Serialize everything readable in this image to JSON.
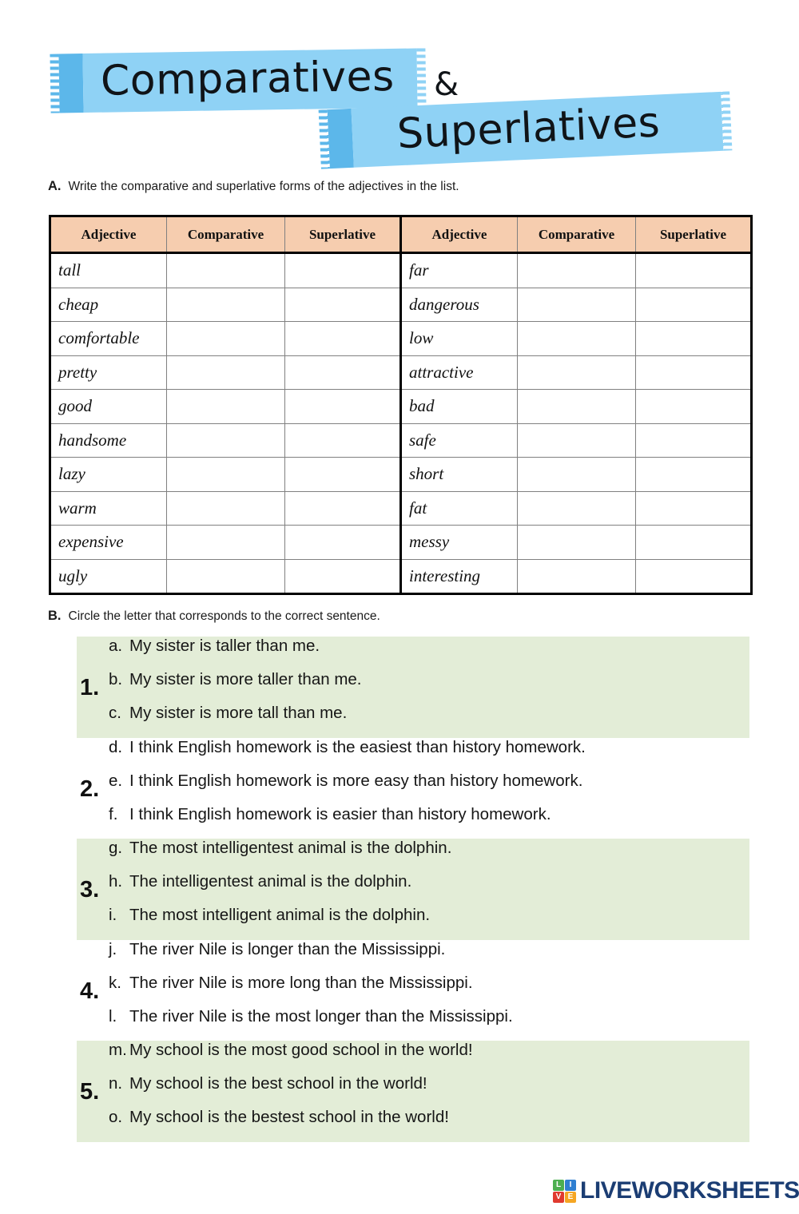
{
  "title": {
    "line1": "Comparatives",
    "ampersand": "&",
    "line2": "Superlatives"
  },
  "colors": {
    "banner_body": "#8fd2f5",
    "banner_tab": "#5cb7ea",
    "table_header_bg": "#f6cdaf",
    "question_band_bg": "#e3edd7",
    "logo_wordmark": "#1b3d73"
  },
  "section_a": {
    "letter": "A.",
    "instruction": "Write the comparative and superlative forms of the adjectives in the list.",
    "table": {
      "headers": [
        "Adjective",
        "Comparative",
        "Superlative",
        "Adjective",
        "Comparative",
        "Superlative"
      ],
      "rows": [
        {
          "left_adjective": "tall",
          "left_comparative": "",
          "left_superlative": "",
          "right_adjective": "far",
          "right_comparative": "",
          "right_superlative": ""
        },
        {
          "left_adjective": "cheap",
          "left_comparative": "",
          "left_superlative": "",
          "right_adjective": "dangerous",
          "right_comparative": "",
          "right_superlative": ""
        },
        {
          "left_adjective": "comfortable",
          "left_comparative": "",
          "left_superlative": "",
          "right_adjective": "low",
          "right_comparative": "",
          "right_superlative": ""
        },
        {
          "left_adjective": "pretty",
          "left_comparative": "",
          "left_superlative": "",
          "right_adjective": "attractive",
          "right_comparative": "",
          "right_superlative": ""
        },
        {
          "left_adjective": "good",
          "left_comparative": "",
          "left_superlative": "",
          "right_adjective": "bad",
          "right_comparative": "",
          "right_superlative": ""
        },
        {
          "left_adjective": "handsome",
          "left_comparative": "",
          "left_superlative": "",
          "right_adjective": "safe",
          "right_comparative": "",
          "right_superlative": ""
        },
        {
          "left_adjective": "lazy",
          "left_comparative": "",
          "left_superlative": "",
          "right_adjective": "short",
          "right_comparative": "",
          "right_superlative": ""
        },
        {
          "left_adjective": "warm",
          "left_comparative": "",
          "left_superlative": "",
          "right_adjective": "fat",
          "right_comparative": "",
          "right_superlative": ""
        },
        {
          "left_adjective": "expensive",
          "left_comparative": "",
          "left_superlative": "",
          "right_adjective": "messy",
          "right_comparative": "",
          "right_superlative": ""
        },
        {
          "left_adjective": "ugly",
          "left_comparative": "",
          "left_superlative": "",
          "right_adjective": "interesting",
          "right_comparative": "",
          "right_superlative": ""
        }
      ]
    }
  },
  "section_b": {
    "letter": "B.",
    "instruction": "Circle the letter that corresponds to the correct sentence.",
    "groups": [
      {
        "number": "1.",
        "shaded": true,
        "options": [
          {
            "letter": "a.",
            "text": "My sister is taller than me."
          },
          {
            "letter": "b.",
            "text": "My sister is more taller than me."
          },
          {
            "letter": "c.",
            "text": "My sister is more tall than me."
          }
        ]
      },
      {
        "number": "2.",
        "shaded": false,
        "options": [
          {
            "letter": "d.",
            "text": "I think English homework is the easiest than history homework."
          },
          {
            "letter": "e.",
            "text": "I think English homework is more easy than history homework."
          },
          {
            "letter": "f.",
            "text": "I think English homework is easier than history homework."
          }
        ]
      },
      {
        "number": "3.",
        "shaded": true,
        "options": [
          {
            "letter": "g.",
            "text": "The most intelligentest animal is the dolphin."
          },
          {
            "letter": "h.",
            "text": "The intelligentest animal is the dolphin."
          },
          {
            "letter": "i.",
            "text": "The most intelligent animal is the dolphin."
          }
        ]
      },
      {
        "number": "4.",
        "shaded": false,
        "options": [
          {
            "letter": "j.",
            "text": "The river Nile is longer than the Mississippi."
          },
          {
            "letter": "k.",
            "text": "The river Nile is more long than the Mississippi."
          },
          {
            "letter": "l.",
            "text": "The river Nile is the most longer than the Mississippi."
          }
        ]
      },
      {
        "number": "5.",
        "shaded": true,
        "options": [
          {
            "letter": "m.",
            "text": "My school is the most good school in the world!"
          },
          {
            "letter": "n.",
            "text": "My school is the best school in the world!"
          },
          {
            "letter": "o.",
            "text": "My school is the bestest school in the world!"
          }
        ]
      }
    ]
  },
  "footer": {
    "logo_squares": [
      "L",
      "I",
      "V",
      "E"
    ],
    "wordmark": "LIVEWORKSHEETS"
  }
}
